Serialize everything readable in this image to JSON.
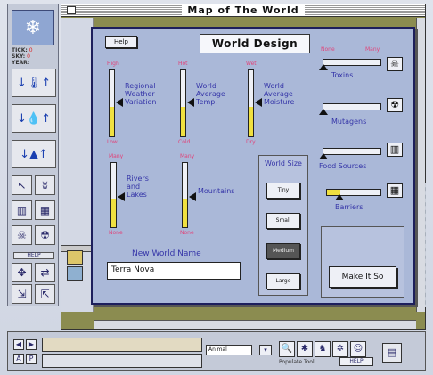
{
  "map_window": {
    "title": "Map of The World"
  },
  "palette": {
    "stats": [
      {
        "label": "TICK:",
        "value": "0"
      },
      {
        "label": "SKY:",
        "value": "0"
      },
      {
        "label": "YEAR:",
        "value": ""
      }
    ],
    "help_label": "HELP"
  },
  "dialog": {
    "title": "World Design",
    "help_label": "Help",
    "vertical_sliders": [
      {
        "top": "High",
        "bottom": "Low",
        "label": "Regional Weather Variation",
        "level": 0.45
      },
      {
        "top": "Hot",
        "bottom": "Cold",
        "label": "World Average Temp.",
        "level": 0.45
      },
      {
        "top": "Wet",
        "bottom": "Dry",
        "label": "World Average Moisture",
        "level": 0.45
      },
      {
        "top": "Many",
        "bottom": "None",
        "label": "Rivers and Lakes",
        "level": 0.45
      },
      {
        "top": "Many",
        "bottom": "None",
        "label": "Mountains",
        "level": 0.45
      }
    ],
    "toxins": {
      "left": "None",
      "right": "Many",
      "label": "Toxins",
      "level": 0.0,
      "icon": "skull-icon"
    },
    "mutagens": {
      "label": "Mutagens",
      "level": 0.0,
      "icon": "radiation-icon"
    },
    "food_sources": {
      "label": "Food Sources",
      "level": 0.0,
      "icon": "food-icon"
    },
    "barriers": {
      "label": "Barriers",
      "level": 0.25,
      "icon": "barrier-icon"
    },
    "world_size": {
      "heading": "World Size",
      "options": [
        "Tiny",
        "Small",
        "Medium",
        "Large"
      ],
      "selected": "Medium"
    },
    "new_world_name": {
      "label": "New World Name",
      "value": "Terra Nova"
    },
    "make_it_so": "Make It So"
  },
  "bottom_toolbar": {
    "animal_field": "Animal",
    "populate_label": "Populate Tool",
    "help_label": "HELP"
  },
  "colors": {
    "dialog_bg": "#aab8d8",
    "slider_fill": "#f0e040",
    "scale_label": "#e0447a",
    "text_blue": "#3535a8"
  }
}
